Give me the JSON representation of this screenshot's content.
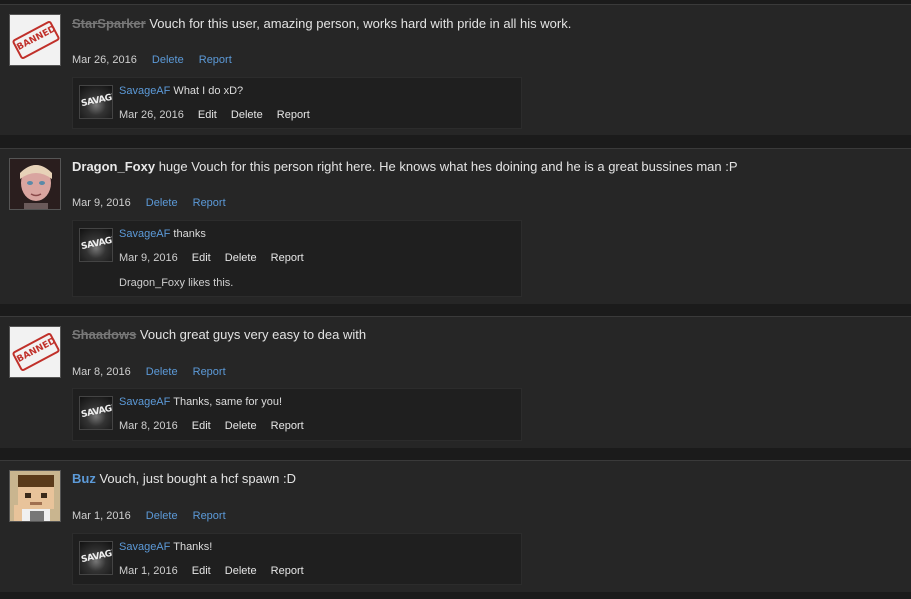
{
  "posts": [
    {
      "username": "StarSparker",
      "message": " Vouch for this user, amazing person, works hard with pride in all his work.",
      "date": "Mar 26, 2016",
      "delete_label": "Delete",
      "report_label": "Report",
      "avatar_text": "BANNED",
      "reply": {
        "username": "SavageAF",
        "message": " What I do xD?",
        "date": "Mar 26, 2016",
        "edit_label": "Edit",
        "delete_label": "Delete",
        "report_label": "Report"
      }
    },
    {
      "username": "Dragon_Foxy",
      "message": " huge Vouch for this person right here. He knows what hes doining and he is a great bussines man :P",
      "date": "Mar 9, 2016",
      "delete_label": "Delete",
      "report_label": "Report",
      "reply": {
        "username": "SavageAF",
        "message": " thanks",
        "date": "Mar 9, 2016",
        "edit_label": "Edit",
        "delete_label": "Delete",
        "report_label": "Report",
        "likes": "Dragon_Foxy likes this."
      }
    },
    {
      "username": "Shaadows",
      "message": " Vouch great guys very easy to dea with",
      "date": "Mar 8, 2016",
      "delete_label": "Delete",
      "report_label": "Report",
      "avatar_text": "BANNED",
      "reply": {
        "username": "SavageAF",
        "message": " Thanks, same for you!",
        "date": "Mar 8, 2016",
        "edit_label": "Edit",
        "delete_label": "Delete",
        "report_label": "Report"
      }
    },
    {
      "username": "Buz",
      "message": " Vouch, just bought a hcf spawn :D",
      "date": "Mar 1, 2016",
      "delete_label": "Delete",
      "report_label": "Report",
      "reply": {
        "username": "SavageAF",
        "message": " Thanks!",
        "date": "Mar 1, 2016",
        "edit_label": "Edit",
        "delete_label": "Delete",
        "report_label": "Report"
      }
    }
  ],
  "reply_avatar_text": "SAVAGE"
}
